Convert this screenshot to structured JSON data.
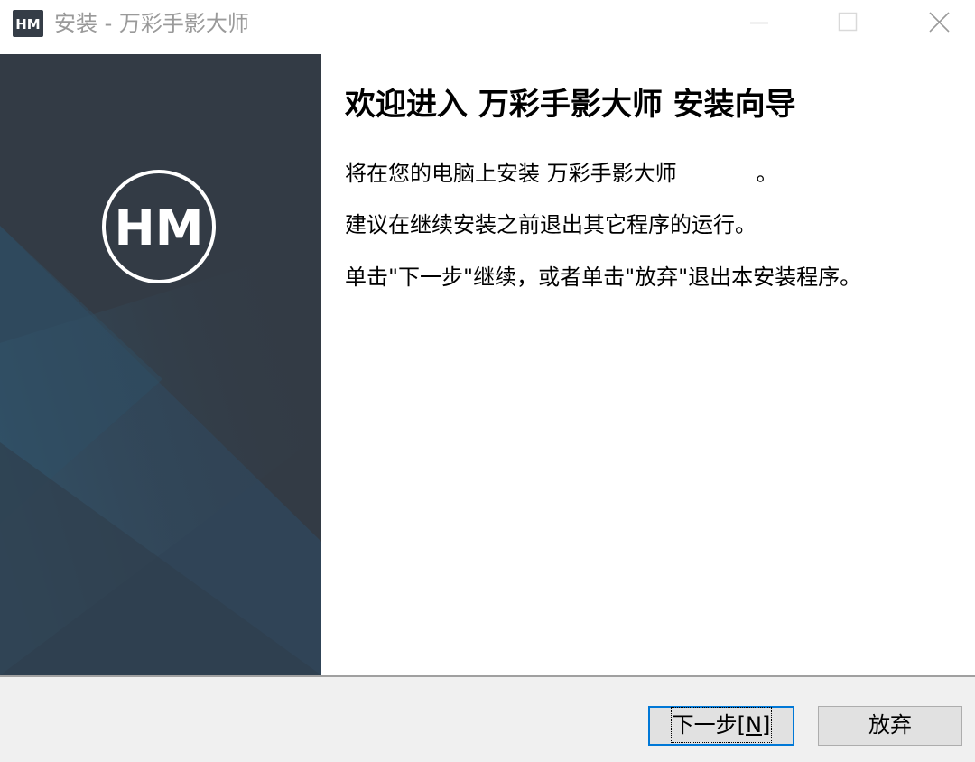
{
  "window": {
    "title": "安装 - 万彩手影大师",
    "icon": "hm-logo-icon"
  },
  "window_controls": {
    "minimize_icon": "minimize-icon",
    "maximize_icon": "maximize-icon",
    "close_icon": "close-icon"
  },
  "banner": {
    "logo_text": "HM",
    "colors": {
      "background": "#333b45",
      "stripe": "#2f4a5e"
    }
  },
  "content": {
    "heading": "欢迎进入 万彩手影大师 安装向导",
    "line1_prefix": "将在您的电脑上安装 万彩手影大师",
    "line1_suffix": "。",
    "line2": "建议在继续安装之前退出其它程序的运行。",
    "line3": "单击\"下一步\"继续，或者单击\"放弃\"退出本安装程序。"
  },
  "footer": {
    "next_label": "下一步",
    "next_accel_open": "[",
    "next_accel": "N",
    "next_accel_close": "]",
    "cancel_label": "放弃"
  },
  "colors": {
    "accent": "#0078d7",
    "footer_bg": "#f0f0f0",
    "button_bg": "#e1e1e1"
  }
}
